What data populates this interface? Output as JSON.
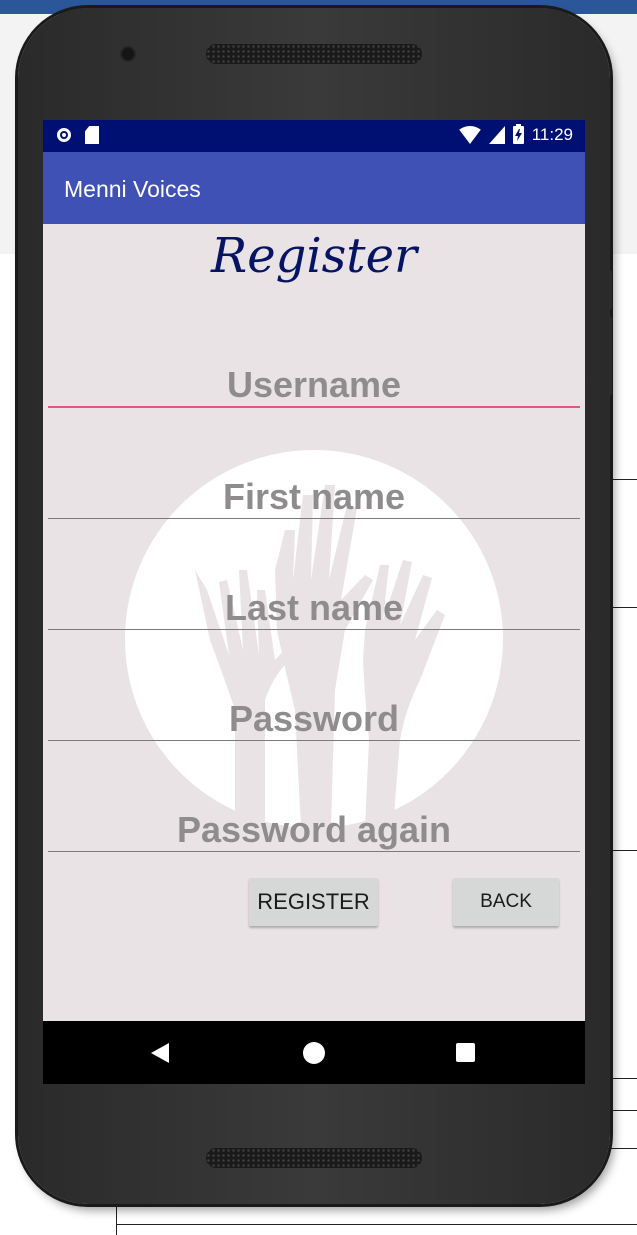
{
  "status_bar": {
    "time": "11:29",
    "icons": [
      "record-icon",
      "sd-card-icon",
      "wifi-icon",
      "signal-icon",
      "battery-charging-icon"
    ]
  },
  "app_bar": {
    "title": "Menni Voices"
  },
  "form": {
    "heading": "Register",
    "fields": {
      "username": {
        "placeholder": "Username",
        "value": ""
      },
      "first_name": {
        "placeholder": "First name",
        "value": ""
      },
      "last_name": {
        "placeholder": "Last name",
        "value": ""
      },
      "password": {
        "placeholder": "Password",
        "value": ""
      },
      "password_again": {
        "placeholder": "Password again",
        "value": ""
      }
    },
    "register_label": "REGISTER",
    "back_label": "BACK"
  },
  "nav_bar": {
    "icons": [
      "back-triangle-icon",
      "home-circle-icon",
      "recents-square-icon"
    ]
  },
  "colors": {
    "status_bar": "#001072",
    "app_bar": "#3f51b5",
    "screen_bg": "#e9e3e6",
    "heading": "#061463",
    "focus_underline": "#e8547d",
    "placeholder": "#8e8c8d"
  }
}
